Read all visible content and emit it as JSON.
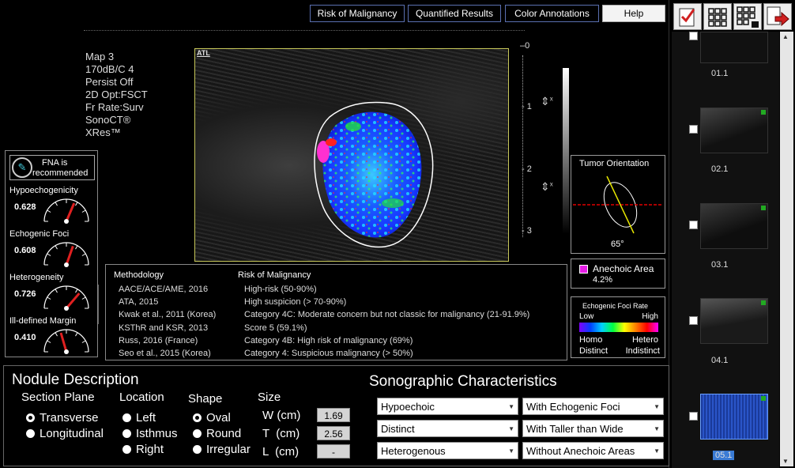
{
  "tabs": [
    "Risk of Malignancy",
    "Quantified Results",
    "Color Annotations",
    "Help"
  ],
  "params": [
    "Map 3",
    "170dB/C 4",
    "Persist Off",
    "2D Opt:FSCT",
    "Fr Rate:Surv",
    "SonoCT®",
    "XRes™"
  ],
  "atl_logo": "ATL",
  "depth_marks": [
    "0",
    "1",
    "2",
    "3"
  ],
  "depth_cursor_label": "x",
  "fna": {
    "text_line1": "FNA is",
    "text_line2": "recommended"
  },
  "gauges": [
    {
      "label": "Hypoechogenicity",
      "value": 0.628
    },
    {
      "label": "Echogenic Foci",
      "value": 0.608
    },
    {
      "label": "Heterogeneity",
      "value": 0.726
    },
    {
      "label": "Ill-defined Margin",
      "value": 0.41
    }
  ],
  "methodology": {
    "header_left": "Methodology",
    "header_right": "Risk of Malignancy",
    "rows": [
      {
        "method": "AACE/ACE/AME, 2016",
        "risk": "High-risk (50-90%)"
      },
      {
        "method": "ATA, 2015",
        "risk": "High suspicion (> 70-90%)"
      },
      {
        "method": "Kwak et al., 2011 (Korea)",
        "risk": "Category 4C: Moderate concern but not classic for malignancy (21-91.9%)"
      },
      {
        "method": "KSThR and KSR, 2013",
        "risk": "Score 5 (59.1%)"
      },
      {
        "method": "Russ, 2016 (France)",
        "risk": "Category 4B: High risk of malignancy (69%)"
      },
      {
        "method": "Seo et al., 2015 (Korea)",
        "risk": "Category 4: Suspicious malignancy (> 50%)"
      }
    ]
  },
  "tumor_orientation": {
    "title": "Tumor Orientation",
    "angle_label": "65°",
    "angle_deg": 65
  },
  "anechoic": {
    "label": "Anechoic Area",
    "value": "4.2%",
    "color": "#e51ee5"
  },
  "foci_rate": {
    "title": "Echogenic Foci Rate",
    "low": "Low",
    "high": "High",
    "homo": "Homo",
    "hetero": "Hetero",
    "distinct": "Distinct",
    "indistinct": "Indistinct"
  },
  "nodule": {
    "title": "Nodule Description",
    "section_plane": {
      "title": "Section Plane",
      "options": [
        "Transverse",
        "Longitudinal"
      ],
      "selected": 0
    },
    "location": {
      "title": "Location",
      "options": [
        "Left",
        "Isthmus",
        "Right"
      ],
      "selected": -1
    },
    "shape": {
      "title": "Shape",
      "options": [
        "Oval",
        "Round",
        "Irregular"
      ],
      "selected": 0
    },
    "size": {
      "title": "Size",
      "rows": [
        {
          "label": "W (cm)",
          "value": "1.69"
        },
        {
          "label": "T  (cm)",
          "value": "2.56"
        },
        {
          "label": "L  (cm)",
          "value": "-"
        }
      ]
    }
  },
  "sonographic": {
    "title": "Sonographic Characteristics",
    "left": [
      "Hypoechoic",
      "Distinct",
      "Heterogenous"
    ],
    "right": [
      "With Echogenic Foci",
      "With Taller than Wide",
      "Without Anechoic Areas"
    ]
  },
  "thumbnails": [
    "01.1",
    "02.1",
    "03.1",
    "04.1",
    "05.1"
  ],
  "selected_thumbnail": "05.1",
  "colors": {
    "accent_border": "#5a6fb0",
    "selected_thumb": "#3a7bd5",
    "needle": "#e02020",
    "margin_outline": "#ffffff",
    "orientation_line": "#e6e600",
    "orientation_ref": "#e00000"
  }
}
